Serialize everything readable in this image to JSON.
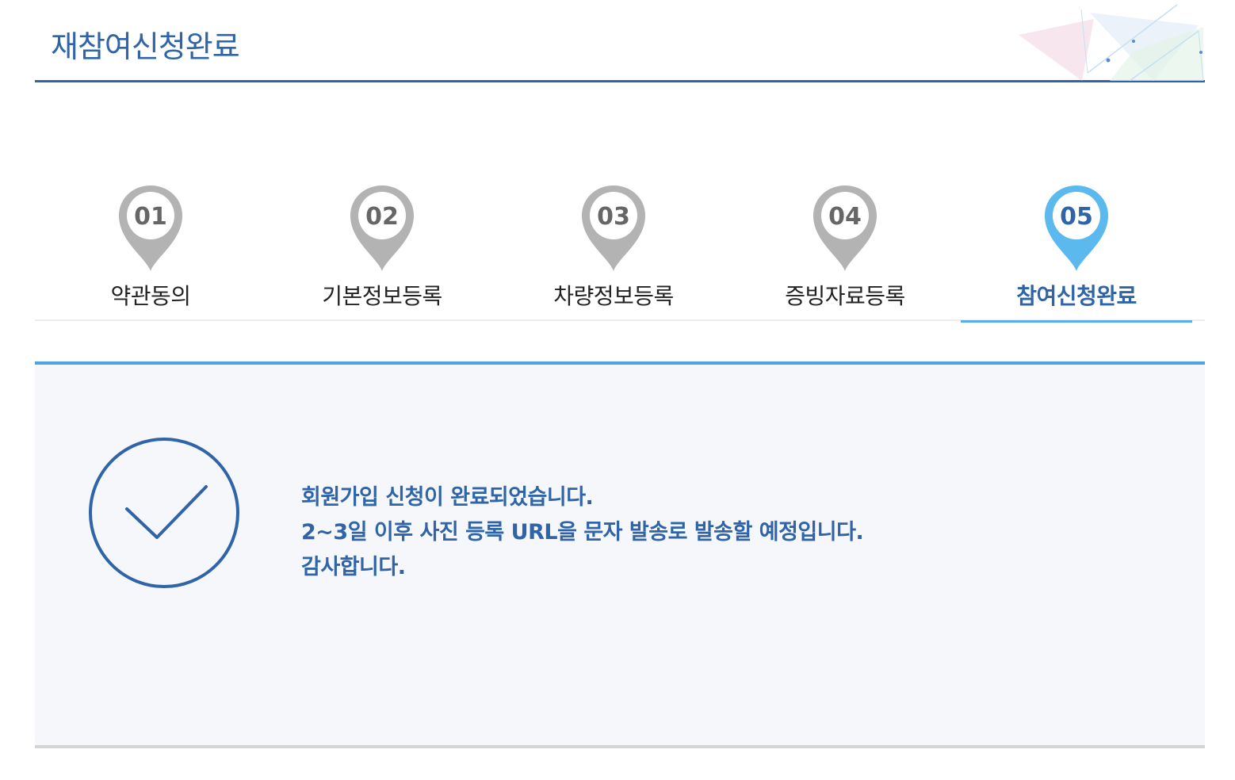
{
  "page": {
    "title": "재참여신청완료"
  },
  "steps": [
    {
      "number": "01",
      "label": "약관동의",
      "state": "inactive"
    },
    {
      "number": "02",
      "label": "기본정보등록",
      "state": "inactive"
    },
    {
      "number": "03",
      "label": "차량정보등록",
      "state": "inactive"
    },
    {
      "number": "04",
      "label": "증빙자료등록",
      "state": "inactive"
    },
    {
      "number": "05",
      "label": "참여신청완료",
      "state": "active"
    }
  ],
  "result": {
    "icon": "check-circle-icon",
    "lines": [
      "회원가입 신청이 완료되었습니다.",
      "2~3일 이후 사진 등록 URL을 문자 발송로 발송할 예정입니다.",
      "감사합니다."
    ]
  },
  "colors": {
    "primary": "#2f64a9",
    "active_step": "#5bb9ee",
    "inactive_step": "#b3b3b3",
    "panel_background": "#f5f7fb",
    "panel_top_border": "#4ea4e3"
  }
}
